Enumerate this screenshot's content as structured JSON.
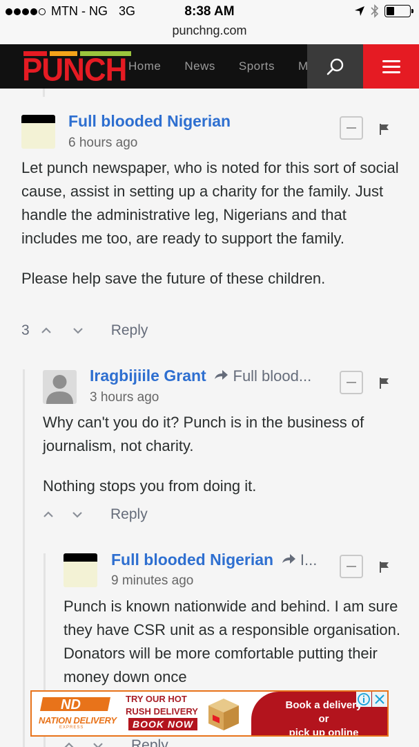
{
  "status_bar": {
    "carrier": "MTN - NG",
    "network": "3G",
    "time": "8:38 AM",
    "url": "punchng.com",
    "signal_bars_filled": 4,
    "signal_bars_total": 5,
    "battery_level": 0.3
  },
  "nav": {
    "logo_text": "PUNCH",
    "links": [
      "Home",
      "News",
      "Sports",
      "M"
    ],
    "search_icon": "search-icon",
    "menu_icon": "hamburger-menu-icon",
    "colors": {
      "brand_red": "#e51b23",
      "nav_bg": "#111111"
    }
  },
  "comments": [
    {
      "author": "Full blooded Nigerian",
      "reply_to": "",
      "time": "6 hours ago",
      "paragraphs": [
        "Let punch newspaper, who is noted for this sort of social cause, assist in setting up a charity for the family. Just handle the administrative leg, Nigerians and that includes me too, are ready to support the family.",
        "Please help save the future of these children."
      ],
      "votes": "3",
      "reply_label": "Reply"
    },
    {
      "author": "Iragbijiile Grant",
      "reply_to": "Full blood...",
      "time": "3 hours ago",
      "paragraphs": [
        "Why can't you do it? Punch is in the business of journalism, not charity.",
        "Nothing stops you from doing it."
      ],
      "votes": "",
      "reply_label": "Reply"
    },
    {
      "author": "Full blooded Nigerian",
      "reply_to": "I...",
      "time": "9 minutes ago",
      "paragraphs": [
        "Punch is known nationwide and behind. I am sure they have CSR unit as a responsible organisation. Donators will be more comfortable putting their money down once"
      ],
      "votes": "",
      "reply_label": "Reply"
    }
  ],
  "ad": {
    "brand_line1": "NATION DELIVERY",
    "brand_line2": "EXPRESS",
    "promo_line1": "TRY OUR HOT",
    "promo_line2": "RUSH DELIVERY",
    "cta": "BOOK NOW",
    "right_line1": "Book a delivery or",
    "right_line2": "pick up online"
  }
}
